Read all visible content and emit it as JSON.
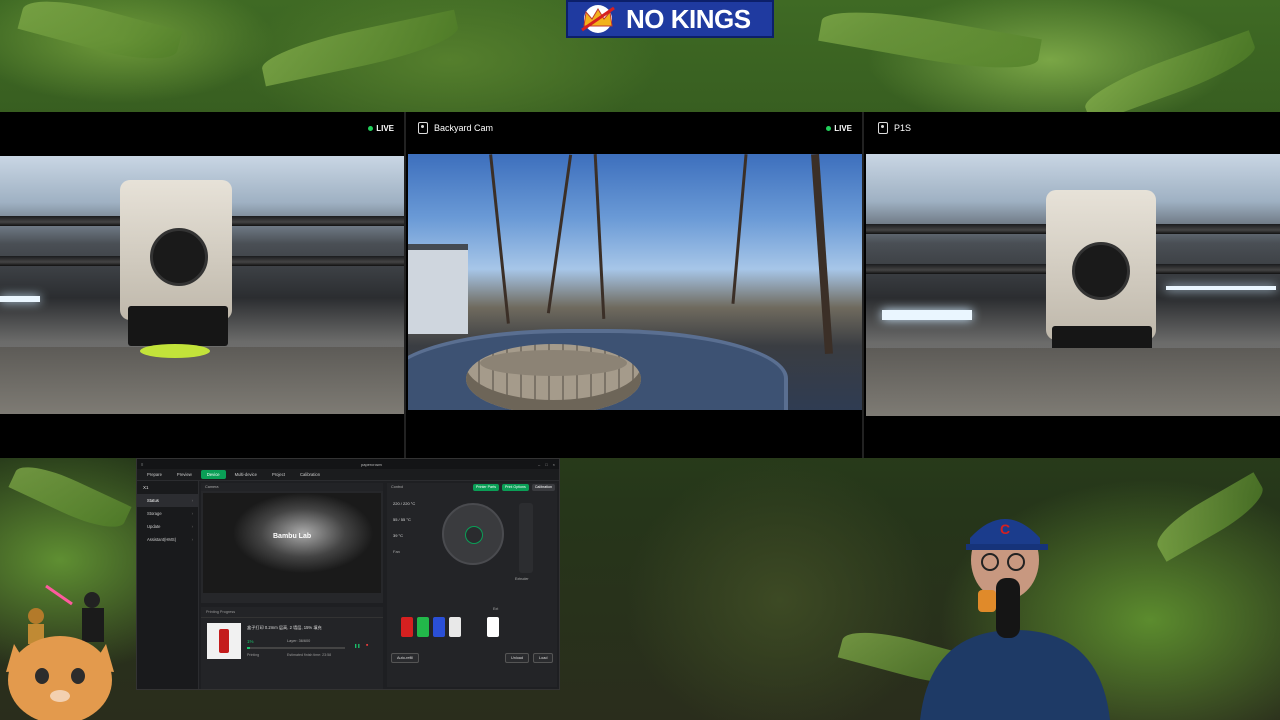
{
  "banner": {
    "text": "NO KINGS"
  },
  "cameras": [
    {
      "title": "",
      "status": "LIVE"
    },
    {
      "title": "Backyard Cam",
      "status": "LIVE"
    },
    {
      "title": "P1S",
      "status": ""
    }
  ],
  "studio": {
    "window_title": "papercrown",
    "tabs": [
      "Prepare",
      "Preview",
      "Device",
      "Multi-device",
      "Project",
      "Calibration"
    ],
    "active_tab": "Device",
    "device_name": "X1",
    "sidebar": [
      "Status",
      "Storage",
      "Update",
      "Assistant(HMS)"
    ],
    "camera_label": "Camera",
    "camera_logo": "Bambu Lab",
    "printing_label": "Printing Progress",
    "print_name": "盒子打印 0.2mm 层高, 2 墙层, 15% 填充",
    "progress_percent": "1%",
    "progress_fraction": 0.01,
    "layer": "Layer: 36/600",
    "time_left": "2h12m",
    "state": "Printing",
    "estimated": "Estimated finish time: 23:58",
    "control_label": "Control",
    "buttons": [
      "Printer Parts",
      "Print Options",
      "Calibration"
    ],
    "temps": [
      "220 / 220 °C",
      "55 / 55 °C",
      "39 °C"
    ],
    "fan_label": "Fan",
    "extruder_label": "Extruder",
    "ext_label": "Ext",
    "ams_labels": [
      "PLA",
      "PLA",
      "PLA",
      "PLA"
    ],
    "ams_colors": [
      "#d62020",
      "#22b84a",
      "#2a4fd6",
      "#e8e8e8"
    ],
    "auto_refill": "Auto-refill",
    "unload": "Unload",
    "load": "Load"
  },
  "colors": {
    "accent": "#0a9e56",
    "live": "#21d05a",
    "banner": "#1f3aa0"
  }
}
